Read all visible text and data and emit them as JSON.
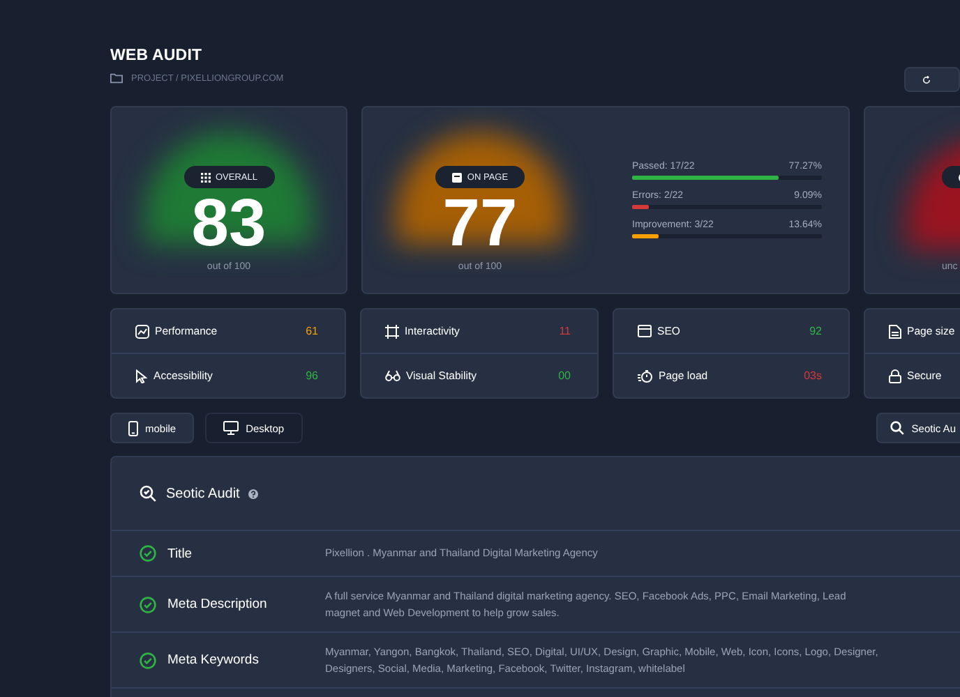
{
  "header": {
    "title": "WEB AUDIT",
    "breadcrumb": "PROJECT / PIXELLIONGROUP.COM"
  },
  "score_cards": [
    {
      "badge": "OVERALL",
      "score": "83",
      "caption": "out of 100",
      "color": "#1f7a35"
    },
    {
      "badge": "ON PAGE",
      "score": "77",
      "caption": "out of 100",
      "color": "#a65f05",
      "bars": [
        {
          "label": "Passed: 17/22",
          "reading": "77.27%",
          "level": 0.7727,
          "color": "#2fb344"
        },
        {
          "label": "Errors: 2/22",
          "reading": "9.09%",
          "level": 0.0909,
          "color": "#d63939"
        },
        {
          "label": "Improvement: 3/22",
          "reading": "13.64%",
          "level": 0.1364,
          "color": "#f59f00"
        }
      ]
    },
    {
      "caption": "unc",
      "color": "#9a1420"
    }
  ],
  "stat_cards": [
    {
      "rows": [
        {
          "label": "Performance",
          "value": "61",
          "color": "#f59f00"
        },
        {
          "label": "Accessibility",
          "value": "96",
          "color": "#2fb344"
        }
      ]
    },
    {
      "rows": [
        {
          "label": "Interactivity",
          "value": "11",
          "color": "#d63939"
        },
        {
          "label": "Visual Stability",
          "value": "00",
          "color": "#2fb344"
        }
      ]
    },
    {
      "rows": [
        {
          "label": "SEO",
          "value": "92",
          "color": "#2fb344"
        },
        {
          "label": "Page load",
          "value": "03s",
          "color": "#d63939"
        }
      ]
    },
    {
      "rows": [
        {
          "label": "Page size"
        },
        {
          "label": "Secure"
        }
      ]
    }
  ],
  "view_buttons": [
    {
      "label": "mobile",
      "selected": true
    },
    {
      "label": "Desktop",
      "selected": false
    }
  ],
  "audit_button": "Seotic Au",
  "audit": {
    "title": "Seotic Audit",
    "rows": [
      {
        "name": "Title",
        "passed": true,
        "value": "Pixellion . Myanmar and Thailand Digital Marketing Agency"
      },
      {
        "name": "Meta Description",
        "passed": true,
        "value": "A full service Myanmar and Thailand digital marketing agency. SEO, Facebook Ads, PPC, Email Marketing, Lead magnet and Web Development to help grow sales."
      },
      {
        "name": "Meta Keywords",
        "passed": true,
        "value": "Myanmar, Yangon, Bangkok, Thailand, SEO, Digital, UI/UX, Design, Graphic, Mobile, Web, Icon, Icons, Logo, Designer, Designers, Social, Media, Marketing, Facebook, Twitter, Instagram, whitelabel"
      }
    ]
  }
}
